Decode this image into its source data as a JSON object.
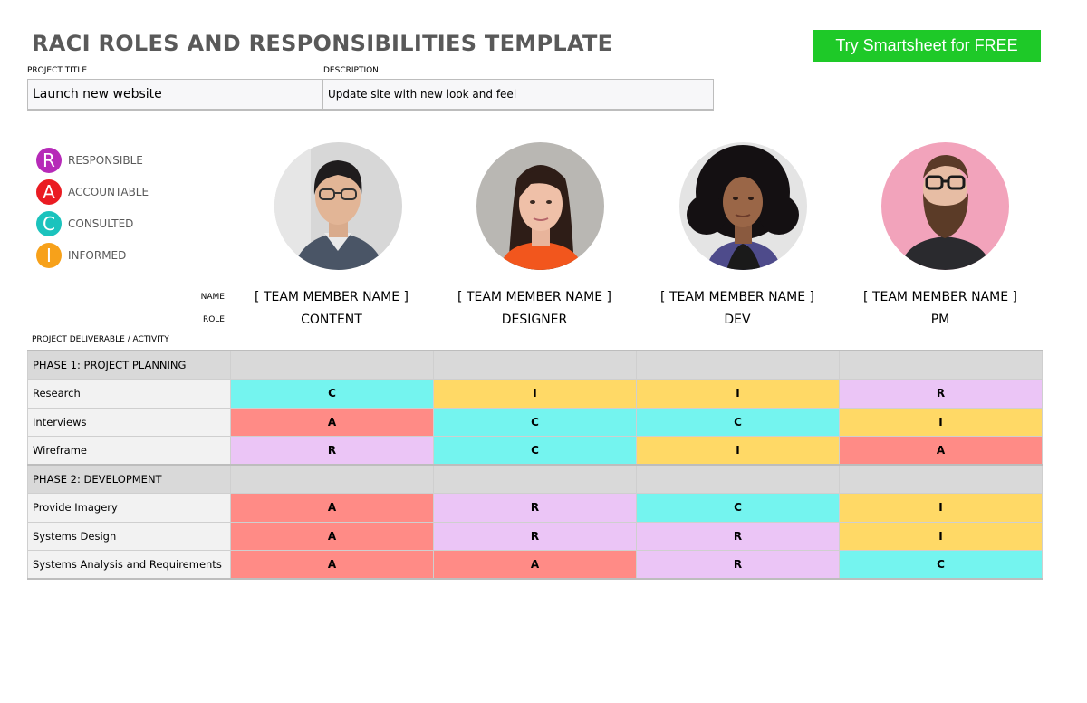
{
  "header": {
    "title": "RACI ROLES AND RESPONSIBILITIES TEMPLATE",
    "cta_label": "Try Smartsheet for FREE",
    "cta_color": "#1ec928"
  },
  "project": {
    "title_label": "PROJECT TITLE",
    "title_value": "Launch new website",
    "description_label": "DESCRIPTION",
    "description_value": "Update site with new look and feel"
  },
  "legend": [
    {
      "letter": "R",
      "label": "RESPONSIBLE",
      "color": "#b62ab8"
    },
    {
      "letter": "A",
      "label": "ACCOUNTABLE",
      "color": "#ea1b22"
    },
    {
      "letter": "C",
      "label": "CONSULTED",
      "color": "#1bc3bd"
    },
    {
      "letter": "I",
      "label": "INFORMED",
      "color": "#f7a11a"
    }
  ],
  "team": {
    "name_label": "NAME",
    "role_label": "ROLE",
    "members": [
      {
        "name": "[ TEAM MEMBER NAME ]",
        "role": "CONTENT",
        "photo": "avatar-photo-man-glasses"
      },
      {
        "name": "[ TEAM MEMBER NAME ]",
        "role": "DESIGNER",
        "photo": "avatar-photo-woman-dark-hair"
      },
      {
        "name": "[ TEAM MEMBER NAME ]",
        "role": "DEV",
        "photo": "avatar-photo-woman-curly-hair"
      },
      {
        "name": "[ TEAM MEMBER NAME ]",
        "role": "PM",
        "photo": "avatar-photo-man-beard"
      }
    ]
  },
  "matrix": {
    "deliverable_label": "PROJECT DELIVERABLE / ACTIVITY",
    "colors": {
      "R": "#ebc5f6",
      "A": "#ff8b86",
      "C": "#74f4ef",
      "I": "#ffd966"
    },
    "phases": [
      {
        "name": "PHASE 1: PROJECT PLANNING",
        "activities": [
          {
            "name": "Research",
            "values": [
              "C",
              "I",
              "I",
              "R"
            ]
          },
          {
            "name": "Interviews",
            "values": [
              "A",
              "C",
              "C",
              "I"
            ]
          },
          {
            "name": "Wireframe",
            "values": [
              "R",
              "C",
              "I",
              "A"
            ]
          }
        ]
      },
      {
        "name": "PHASE 2: DEVELOPMENT",
        "activities": [
          {
            "name": "Provide Imagery",
            "values": [
              "A",
              "R",
              "C",
              "I"
            ]
          },
          {
            "name": "Systems Design",
            "values": [
              "A",
              "R",
              "R",
              "I"
            ]
          },
          {
            "name": "Systems Analysis and Requirements",
            "values": [
              "A",
              "A",
              "R",
              "C"
            ]
          }
        ]
      }
    ]
  }
}
